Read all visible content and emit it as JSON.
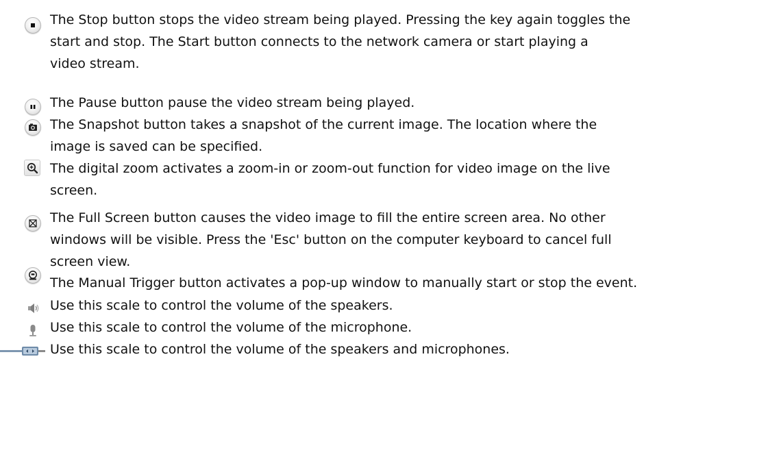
{
  "items": [
    {
      "icon": "stop-icon",
      "text": "The Stop button stops the video stream being played. Pressing the key again toggles the\nstart and stop. The Start button connects to the network camera or start playing a\nvideo stream."
    },
    {
      "icon": "pause-icon",
      "text": "The Pause button pause the video stream being played."
    },
    {
      "icon": "snapshot-icon",
      "text": "The Snapshot button takes a snapshot of the current image. The location where the\nimage is saved can be specified."
    },
    {
      "icon": "digital-zoom-icon",
      "text": "The digital zoom activates a zoom-in or zoom-out function for video image on the live\nscreen."
    },
    {
      "icon": "full-screen-icon",
      "text": "The Full Screen button causes the video image to fill the entire screen area. No other\nwindows will be visible. Press the 'Esc' button on the computer keyboard to cancel full\nscreen view."
    },
    {
      "icon": "manual-trigger-icon",
      "text": "The Manual Trigger button activates a pop-up window to manually start or stop the event."
    },
    {
      "icon": "speaker-icon",
      "text": "Use this scale to control the volume of the speakers."
    },
    {
      "icon": "microphone-icon",
      "text": "Use this scale to control the volume of the microphone."
    },
    {
      "icon": "volume-slider-icon",
      "text": "Use this scale to control the volume of the speakers and microphones."
    }
  ]
}
